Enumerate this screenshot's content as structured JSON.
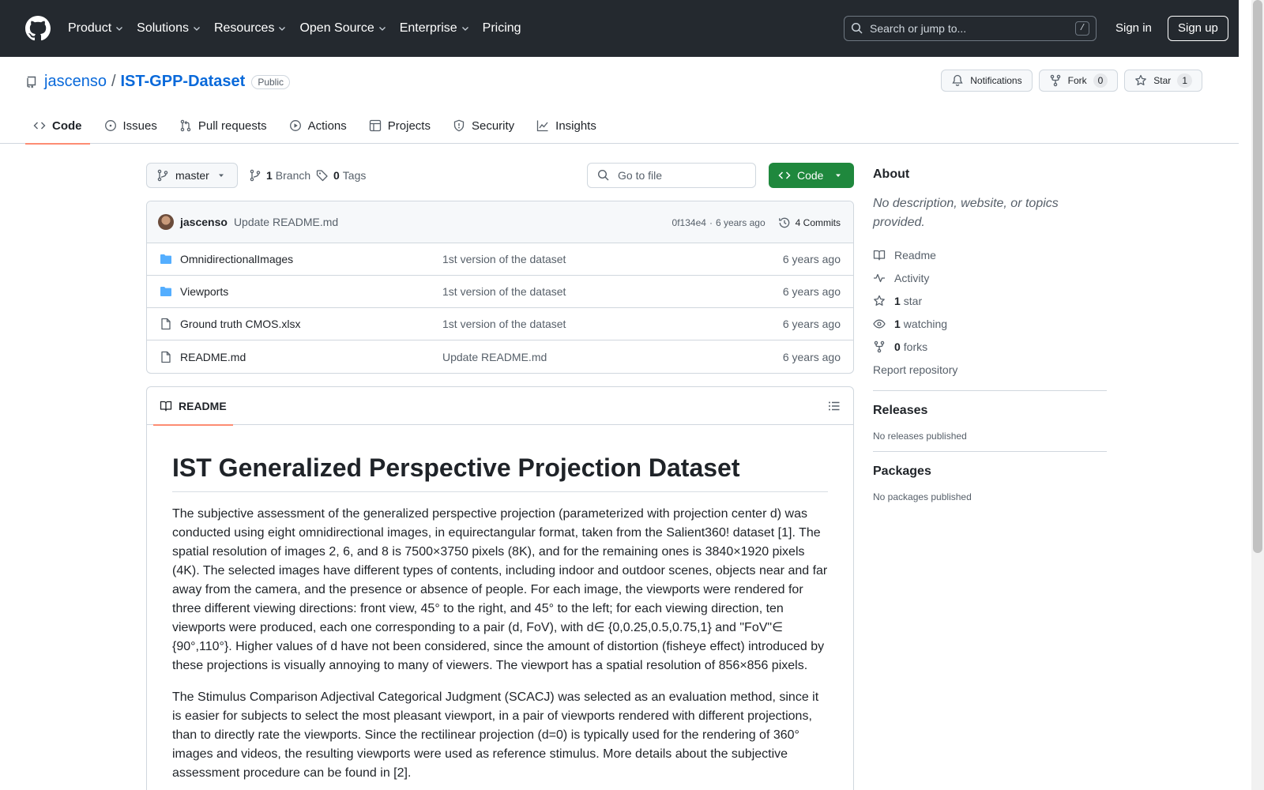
{
  "header": {
    "nav": [
      "Product",
      "Solutions",
      "Resources",
      "Open Source",
      "Enterprise",
      "Pricing"
    ],
    "search_placeholder": "Search or jump to...",
    "search_shortcut": "/",
    "sign_in": "Sign in",
    "sign_up": "Sign up"
  },
  "repo": {
    "owner": "jascenso",
    "separator": "/",
    "name": "IST-GPP-Dataset",
    "visibility": "Public",
    "notifications_label": "Notifications",
    "fork_label": "Fork",
    "fork_count": "0",
    "star_label": "Star",
    "star_count": "1",
    "tabs": [
      "Code",
      "Issues",
      "Pull requests",
      "Actions",
      "Projects",
      "Security",
      "Insights"
    ]
  },
  "toolbar": {
    "branch": "master",
    "branch_count": "1",
    "branch_label": "Branch",
    "tag_count": "0",
    "tag_label": "Tags",
    "goto_placeholder": "Go to file",
    "code_label": "Code"
  },
  "commit": {
    "author": "jascenso",
    "message": "Update README.md",
    "sha": "0f134e4",
    "dot": "·",
    "age": "6 years ago",
    "commits_label": "4 Commits"
  },
  "files": [
    {
      "name": "OmnidirectionalImages",
      "type": "folder",
      "commit": "1st version of the dataset",
      "age": "6 years ago"
    },
    {
      "name": "Viewports",
      "type": "folder",
      "commit": "1st version of the dataset",
      "age": "6 years ago"
    },
    {
      "name": "Ground truth CMOS.xlsx",
      "type": "file",
      "commit": "1st version of the dataset",
      "age": "6 years ago"
    },
    {
      "name": "README.md",
      "type": "file",
      "commit": "Update README.md",
      "age": "6 years ago"
    }
  ],
  "readme": {
    "tab_label": "README",
    "title": "IST Generalized Perspective Projection Dataset",
    "paragraphs": [
      "The subjective assessment of the generalized perspective projection (parameterized with projection center d) was conducted using eight omnidirectional images, in equirectangular format, taken from the Salient360! dataset [1]. The spatial resolution of images 2, 6, and 8 is 7500×3750 pixels (8K), and for the remaining ones is 3840×1920 pixels (4K). The selected images have different types of contents, including indoor and outdoor scenes, objects near and far away from the camera, and the presence or absence of people. For each image, the viewports were rendered for three different viewing directions: front view, 45° to the right, and 45° to the left; for each viewing direction, ten viewports were produced, each one corresponding to a pair (d, FoV), with d∈ {0,0.25,0.5,0.75,1} and \"FoV\"∈ {90°,110°}. Higher values of d have not been considered, since the amount of distortion (fisheye effect) introduced by these projections is visually annoying to many of viewers. The viewport has a spatial resolution of 856×856 pixels.",
      "The Stimulus Comparison Adjectival Categorical Judgment (SCACJ) was selected as an evaluation method, since it is easier for subjects to select the most pleasant viewport, in a pair of viewports rendered with different projections, than to directly rate the viewports. Since the rectilinear projection (d=0) is typically used for the rendering of 360° images and videos, the resulting viewports were used as reference stimulus. More details about the subjective assessment procedure can be found in [2]."
    ]
  },
  "sidebar": {
    "about_title": "About",
    "about_desc": "No description, website, or topics provided.",
    "links": [
      {
        "icon": "book-icon",
        "count": "",
        "label": "Readme"
      },
      {
        "icon": "pulse-icon",
        "count": "",
        "label": "Activity"
      },
      {
        "icon": "star-icon",
        "count": "1",
        "label": "star"
      },
      {
        "icon": "eye-icon",
        "count": "1",
        "label": "watching"
      },
      {
        "icon": "fork-icon",
        "count": "0",
        "label": "forks"
      }
    ],
    "report": "Report repository",
    "releases_title": "Releases",
    "releases_empty": "No releases published",
    "packages_title": "Packages",
    "packages_empty": "No packages published"
  },
  "colors": {
    "header_bg": "#24292f",
    "link": "#0969da",
    "accent_underline": "#fd8c73",
    "primary_button": "#1f883d",
    "folder": "#54aeff"
  }
}
